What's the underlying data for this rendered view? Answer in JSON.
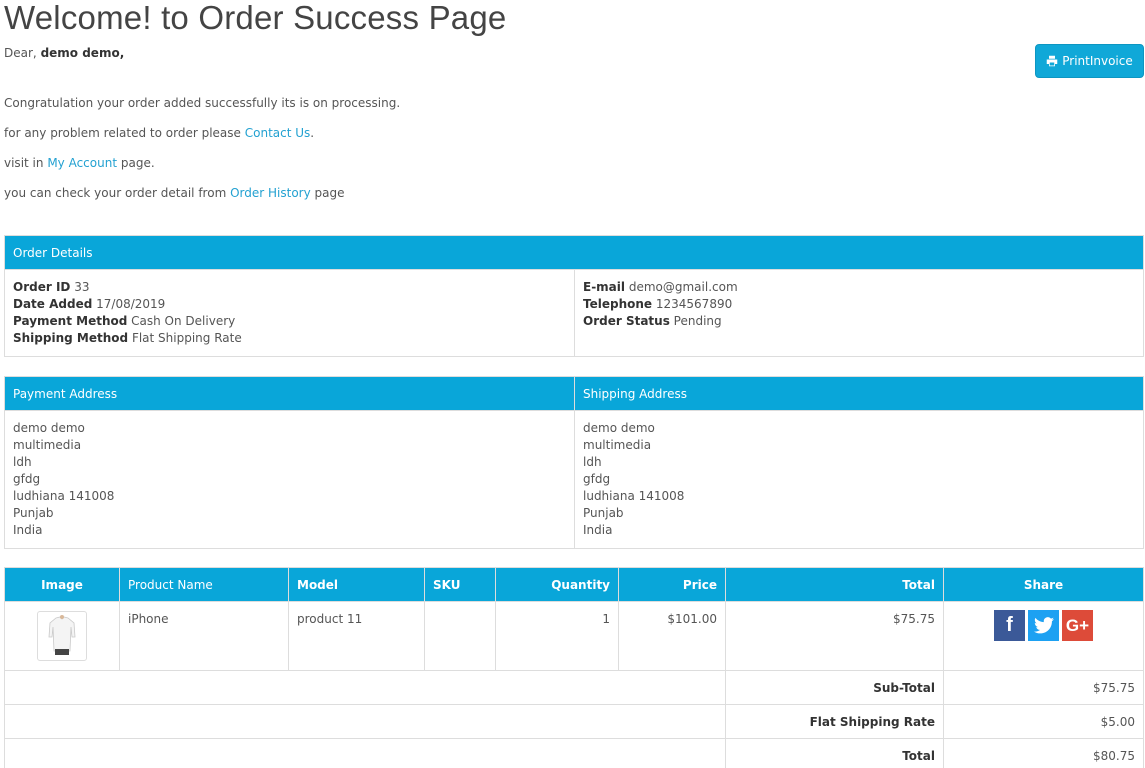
{
  "page": {
    "title": "Welcome! to Order Success Page",
    "dear_prefix": "Dear,",
    "customer_name": "demo demo,",
    "print_button": "PrintInvoice"
  },
  "messages": {
    "line1": "Congratulation your order added successfully its is on processing.",
    "line2_prefix": "for any problem related to order please",
    "line2_link": "Contact Us",
    "line2_suffix": ".",
    "line3_prefix": "visit in",
    "line3_link": "My Account",
    "line3_suffix": "page.",
    "line4_prefix": "you can check your order detail from",
    "line4_link": "Order History",
    "line4_suffix": "page"
  },
  "order_details": {
    "header": "Order Details",
    "order_id_label": "Order ID",
    "order_id": "33",
    "date_label": "Date Added",
    "date": "17/08/2019",
    "payment_method_label": "Payment Method",
    "payment_method": "Cash On Delivery",
    "shipping_method_label": "Shipping Method",
    "shipping_method": "Flat Shipping Rate",
    "email_label": "E-mail",
    "email": "demo@gmail.com",
    "telephone_label": "Telephone",
    "telephone": "1234567890",
    "status_label": "Order Status",
    "status": "Pending"
  },
  "addresses": {
    "payment_header": "Payment Address",
    "shipping_header": "Shipping Address",
    "payment": [
      "demo demo",
      "multimedia",
      "ldh",
      "gfdg",
      "ludhiana 141008",
      "Punjab",
      "India"
    ],
    "shipping": [
      "demo demo",
      "multimedia",
      "ldh",
      "gfdg",
      "ludhiana 141008",
      "Punjab",
      "India"
    ]
  },
  "products": {
    "columns": [
      "Image",
      "Product Name",
      "Model",
      "SKU",
      "Quantity",
      "Price",
      "Total",
      "Share"
    ],
    "rows": [
      {
        "name": "iPhone",
        "model": "product 11",
        "sku": "",
        "quantity": "1",
        "price": "$101.00",
        "total": "$75.75"
      }
    ],
    "share_icons": [
      "facebook-icon",
      "twitter-icon",
      "google-plus-icon"
    ]
  },
  "totals": [
    {
      "label": "Sub-Total",
      "value": "$75.75"
    },
    {
      "label": "Flat Shipping Rate",
      "value": "$5.00"
    },
    {
      "label": "Total",
      "value": "$80.75"
    }
  ],
  "colors": {
    "header_bg": "#09a6d9",
    "link": "#23a1d1",
    "button": "#10a8d8"
  }
}
